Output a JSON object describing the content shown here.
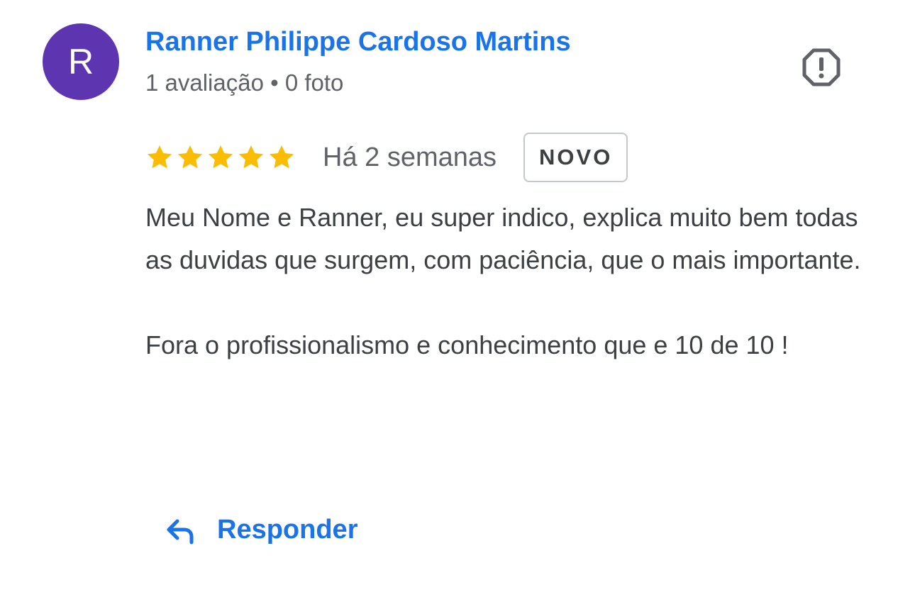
{
  "colors": {
    "accent": "#1a73e8",
    "avatar_bg": "#5e35b1",
    "star": "#fbbc04",
    "text": "#3c4043",
    "muted": "#5f6368"
  },
  "reviewer": {
    "avatar_letter": "R",
    "name": "Ranner Philippe Cardoso Martins",
    "meta": "1 avaliação • 0 foto"
  },
  "report": {
    "icon": "report-icon"
  },
  "rating": {
    "stars": 5,
    "max_stars": 5,
    "time_ago": "Há 2 semanas",
    "badge": "NOVO"
  },
  "review": {
    "paragraph1": "Meu Nome e Ranner, eu super indico, explica muito bem todas as duvidas que surgem, com paciência, que o mais importante.",
    "paragraph2": "Fora o profissionalismo e conhecimento que e 10 de 10 !"
  },
  "actions": {
    "reply_label": "Responder",
    "reply_icon": "reply-icon"
  }
}
